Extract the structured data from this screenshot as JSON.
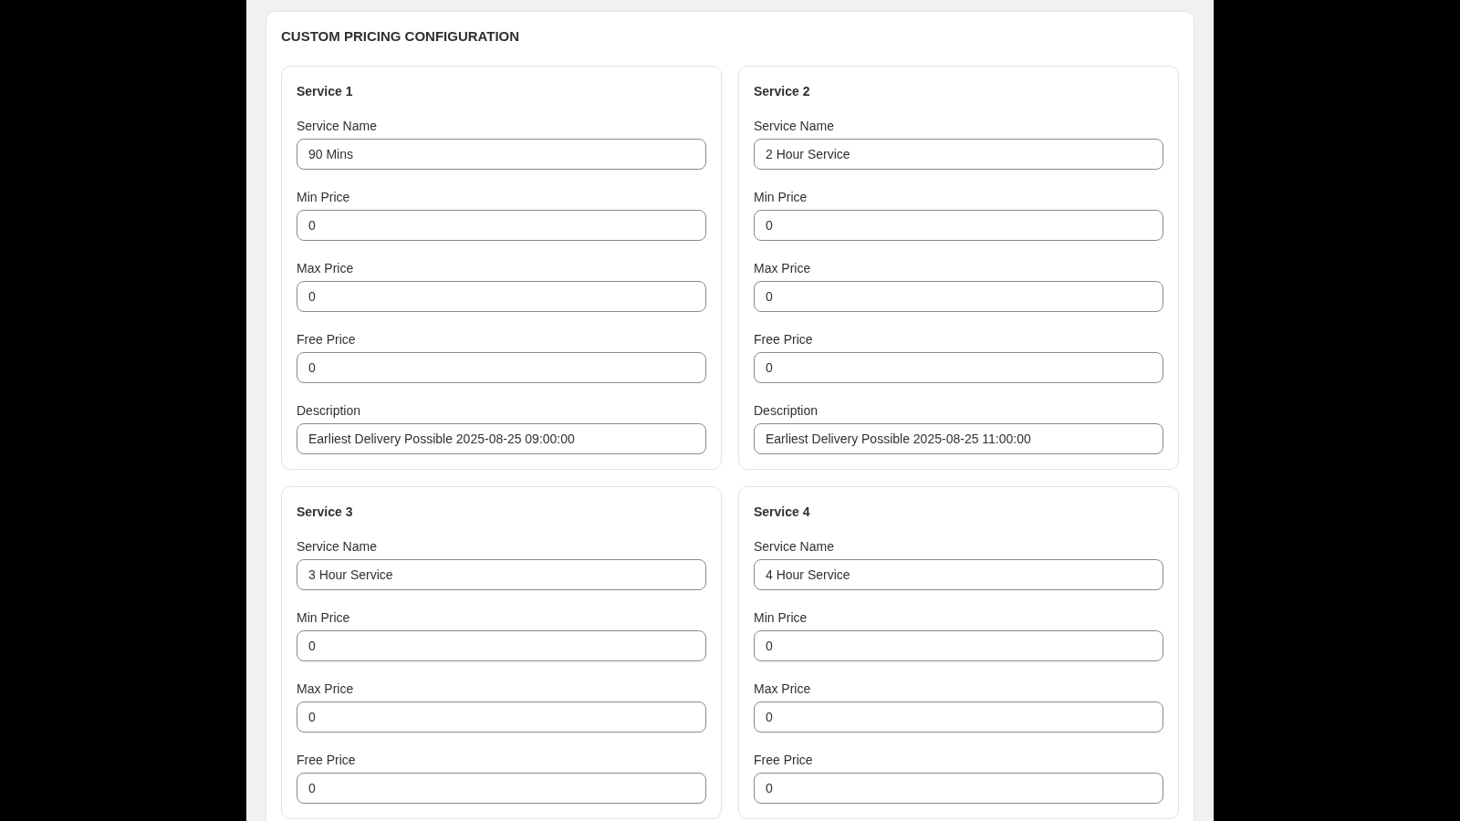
{
  "section_title": "CUSTOM PRICING CONFIGURATION",
  "services": [
    {
      "title": "Service 1",
      "fields": [
        {
          "label": "Service Name",
          "value": "90 Mins"
        },
        {
          "label": "Min Price",
          "value": "0"
        },
        {
          "label": "Max Price",
          "value": "0"
        },
        {
          "label": "Free Price",
          "value": "0"
        },
        {
          "label": "Description",
          "value": "Earliest Delivery Possible 2025-08-25 09:00:00"
        }
      ]
    },
    {
      "title": "Service 2",
      "fields": [
        {
          "label": "Service Name",
          "value": "2 Hour Service"
        },
        {
          "label": "Min Price",
          "value": "0"
        },
        {
          "label": "Max Price",
          "value": "0"
        },
        {
          "label": "Free Price",
          "value": "0"
        },
        {
          "label": "Description",
          "value": "Earliest Delivery Possible 2025-08-25 11:00:00"
        }
      ]
    },
    {
      "title": "Service 3",
      "fields": [
        {
          "label": "Service Name",
          "value": "3 Hour Service"
        },
        {
          "label": "Min Price",
          "value": "0"
        },
        {
          "label": "Max Price",
          "value": "0"
        },
        {
          "label": "Free Price",
          "value": "0"
        }
      ]
    },
    {
      "title": "Service 4",
      "fields": [
        {
          "label": "Service Name",
          "value": "4 Hour Service"
        },
        {
          "label": "Min Price",
          "value": "0"
        },
        {
          "label": "Max Price",
          "value": "0"
        },
        {
          "label": "Free Price",
          "value": "0"
        }
      ]
    }
  ]
}
